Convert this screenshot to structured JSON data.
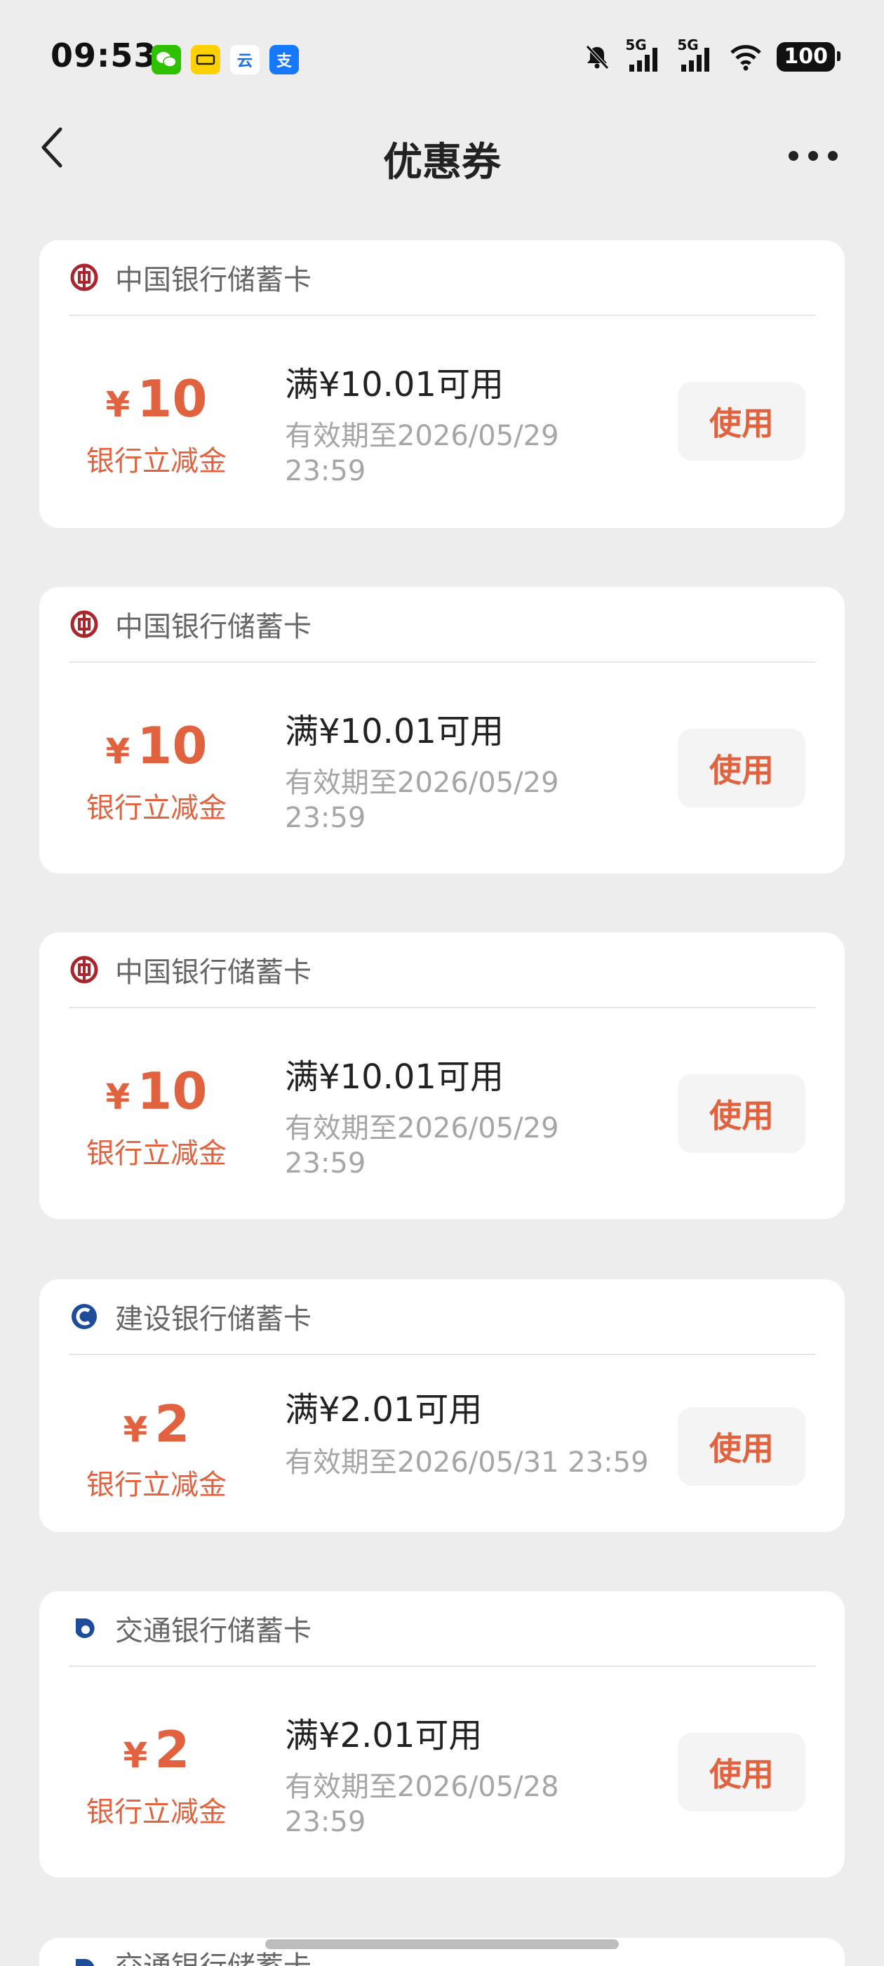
{
  "status_bar": {
    "time": "09:53",
    "battery": "100",
    "network_1": "5G",
    "network_2": "5G",
    "app_icons": [
      "wechat-icon",
      "meituan-icon",
      "yunshanfu-icon",
      "alipay-icon"
    ],
    "alipay_glyph": "支",
    "yun_glyph": "云"
  },
  "nav": {
    "title": "优惠券"
  },
  "coupons": [
    {
      "bank": "中国银行储蓄卡",
      "bank_icon": "boc-logo-icon",
      "currency": "¥",
      "amount": "10",
      "amount_label": "银行立减金",
      "condition": "满¥10.01可用",
      "validity": "有效期至2026/05/29 23:59",
      "button": "使用"
    },
    {
      "bank": "中国银行储蓄卡",
      "bank_icon": "boc-logo-icon",
      "currency": "¥",
      "amount": "10",
      "amount_label": "银行立减金",
      "condition": "满¥10.01可用",
      "validity": "有效期至2026/05/29 23:59",
      "button": "使用"
    },
    {
      "bank": "中国银行储蓄卡",
      "bank_icon": "boc-logo-icon",
      "currency": "¥",
      "amount": "10",
      "amount_label": "银行立减金",
      "condition": "满¥10.01可用",
      "validity": "有效期至2026/05/29 23:59",
      "button": "使用"
    },
    {
      "bank": "建设银行储蓄卡",
      "bank_icon": "ccb-logo-icon",
      "currency": "¥",
      "amount": "2",
      "amount_label": "银行立减金",
      "condition": "满¥2.01可用",
      "validity": "有效期至2026/05/31 23:59",
      "button": "使用"
    },
    {
      "bank": "交通银行储蓄卡",
      "bank_icon": "bocom-logo-icon",
      "currency": "¥",
      "amount": "2",
      "amount_label": "银行立减金",
      "condition": "满¥2.01可用",
      "validity": "有效期至2026/05/28 23:59",
      "button": "使用"
    },
    {
      "bank": "交通银行储蓄卡",
      "bank_icon": "bocom-logo-icon"
    }
  ],
  "colors": {
    "accent": "#e0623f",
    "background": "#ededed",
    "card": "#ffffff"
  }
}
